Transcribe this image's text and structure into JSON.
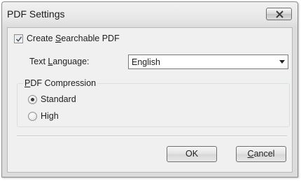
{
  "window": {
    "title": "PDF Settings"
  },
  "searchable": {
    "checked": true,
    "label_pre": "Create ",
    "label_accel": "S",
    "label_post": "earchable PDF"
  },
  "language": {
    "label_pre": "Text ",
    "label_accel": "L",
    "label_post": "anguage:",
    "selected": "English"
  },
  "compression": {
    "title_accel": "P",
    "title_post": "DF Compression",
    "options": [
      {
        "label": "Standard",
        "checked": true
      },
      {
        "label": "High",
        "checked": false
      }
    ]
  },
  "buttons": {
    "ok_label": "OK",
    "cancel_accel": "C",
    "cancel_post": "ancel"
  }
}
